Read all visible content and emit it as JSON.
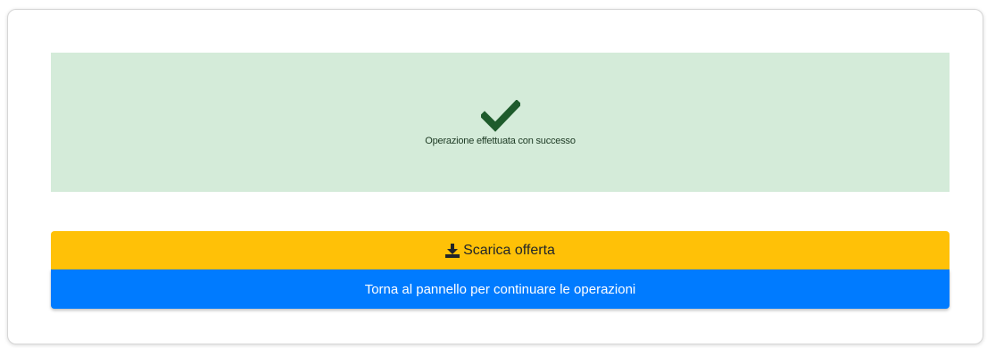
{
  "alert": {
    "icon": "check-icon",
    "message": "Operazione effettuata con successo",
    "background": "#d4ebd9",
    "icon_color": "#1e5b2c"
  },
  "actions": {
    "download_label": "Scarica offerta",
    "download_icon": "download-icon",
    "download_color": "#ffc107",
    "back_label": "Torna al pannello per continuare le operazioni",
    "back_color": "#007bff"
  }
}
